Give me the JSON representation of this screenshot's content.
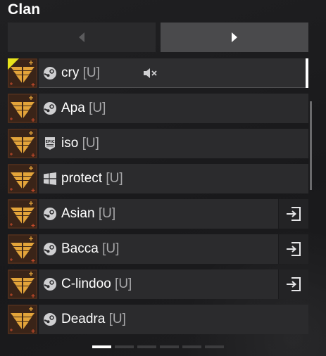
{
  "panel": {
    "title": "Clan"
  },
  "pagination": {
    "page_count": 6,
    "active_index": 0
  },
  "members": [
    {
      "name": "cry",
      "tag": "[U]",
      "platform": "steam-icon",
      "selected": true,
      "muted": true,
      "join": false,
      "leader": true
    },
    {
      "name": "Apa",
      "tag": "[U]",
      "platform": "steam-icon",
      "selected": false,
      "muted": false,
      "join": false,
      "leader": false
    },
    {
      "name": "iso",
      "tag": "[U]",
      "platform": "epic-games-icon",
      "selected": false,
      "muted": false,
      "join": false,
      "leader": false
    },
    {
      "name": "protect",
      "tag": "[U]",
      "platform": "windows-icon",
      "selected": false,
      "muted": false,
      "join": false,
      "leader": false
    },
    {
      "name": "Asian",
      "tag": "[U]",
      "platform": "steam-icon",
      "selected": false,
      "muted": false,
      "join": true,
      "leader": false
    },
    {
      "name": "Bacca",
      "tag": "[U]",
      "platform": "steam-icon",
      "selected": false,
      "muted": false,
      "join": true,
      "leader": false
    },
    {
      "name": "C-lindoo",
      "tag": "[U]",
      "platform": "steam-icon",
      "selected": false,
      "muted": false,
      "join": true,
      "leader": false
    },
    {
      "name": "Deadra",
      "tag": "[U]",
      "platform": "steam-icon",
      "selected": false,
      "muted": false,
      "join": false,
      "leader": false
    }
  ],
  "colors": {
    "accent": "#e8e31c",
    "emblem": "#e3a43a",
    "card": "#2b2b2d"
  }
}
